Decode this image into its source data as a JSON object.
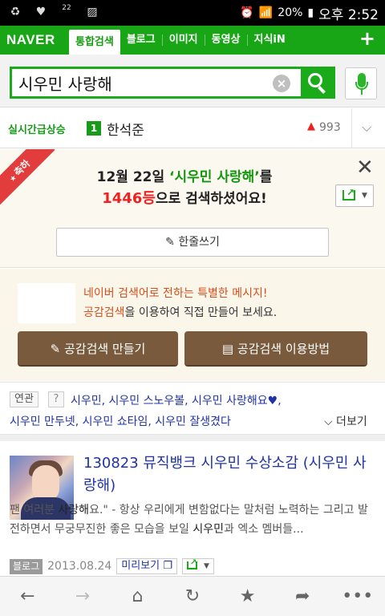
{
  "status_bar": {
    "left_icons": [
      "recycle-icon",
      "music-icon",
      "signal-22-icon",
      "picture-icon"
    ],
    "signal_small": "22",
    "battery": "20%",
    "time": "오후 2:52"
  },
  "nav": {
    "logo": "NAVER",
    "tabs": [
      {
        "label": "통합검색",
        "active": true
      },
      {
        "label": "블로그"
      },
      {
        "label": "이미지"
      },
      {
        "label": "동영상"
      },
      {
        "label": "지식iN"
      }
    ],
    "plus": "+"
  },
  "search": {
    "query": "시우민 사랑해",
    "clear": "×"
  },
  "realtime": {
    "label": "실시간급상승",
    "rank": "1",
    "term": "한석준",
    "change_icon": "▲",
    "count": "993",
    "chevron": "⌵"
  },
  "congrats": {
    "ribbon": "축하",
    "date_prefix": "12월 22일 ",
    "query_quoted": "‘시우민 사랑해’",
    "date_suffix": "를",
    "rank": "1446등",
    "rank_suffix": "으로 검색하셨어요!",
    "close": "✕",
    "write_label": "한줄쓰기",
    "write_icon": "✎"
  },
  "empathy": {
    "line1": "네이버 검색어로 전하는 특별한 메시지!",
    "line2_highlight": "공감검색",
    "line2_rest": "을 이용하여 직접 만들어 보세요.",
    "btn_make": "공감검색 만들기",
    "btn_make_icon": "✎",
    "btn_how": "공감검색 이용방법",
    "btn_how_icon": "▤"
  },
  "related": {
    "tag": "연관",
    "help": "?",
    "line1": "시우민, 시우민 스노우볼, 시우민 사랑해요",
    "heart": "♥",
    "line1_end": ",",
    "line2": "시우민 만두넷, 시우민 쇼타임, 시우민 잘생겼다",
    "more": "⌵ 더보기"
  },
  "result": {
    "title": "130823 뮤직뱅크 시우민 수상소감 (시우민 사랑해)",
    "snippet_pre": "팬 여러분 ",
    "snippet_hl1": "사랑해",
    "snippet_mid": "요.\" - 항상 우리에게 변함없다는 말처럼 노력하는 그리고 발전하면서 무궁무진한 좋은 모습을 보일 ",
    "snippet_hl2": "시우민",
    "snippet_post": "과 엑소 멤버들...",
    "source": "블로그",
    "date": "2013.08.24",
    "preview": "미리보기 ❐"
  },
  "bottom_bar": {
    "back": "←",
    "forward": "→",
    "home": "⌂",
    "refresh": "↻",
    "bookmark": "★",
    "share": "➦",
    "menu": "•••"
  }
}
